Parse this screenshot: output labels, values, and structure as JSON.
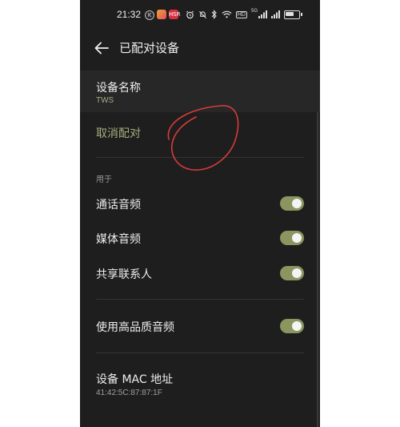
{
  "status_bar": {
    "time": "21:32",
    "app_icon_k": "K",
    "app_icon_3": "HSR",
    "icons": [
      "alarm-icon",
      "bluetooth-icon",
      "wifi-icon",
      "signal-icon",
      "battery-icon"
    ],
    "hd_badge": "HD",
    "net_label": "5G"
  },
  "header": {
    "title": "已配对设备",
    "back_icon": "arrow-left-icon"
  },
  "device": {
    "name_label": "设备名称",
    "name_value": "TWS",
    "unpair_label": "取消配对"
  },
  "usage": {
    "section_label": "用于",
    "items": [
      {
        "label": "通话音频",
        "enabled": true
      },
      {
        "label": "媒体音频",
        "enabled": true
      },
      {
        "label": "共享联系人",
        "enabled": true
      }
    ]
  },
  "hq_audio": {
    "label": "使用高品质音频",
    "enabled": true
  },
  "mac": {
    "label": "设备 MAC 地址",
    "value": "41:42:5C:87:87:1F"
  },
  "colors": {
    "background": "#1e1e1e",
    "accent": "#a6ad7e",
    "toggle_on": "#8a9560",
    "annotation": "#d83a3a"
  }
}
